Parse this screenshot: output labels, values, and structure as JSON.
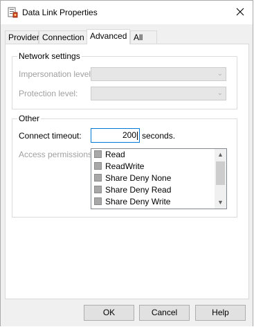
{
  "window": {
    "title": "Data Link Properties"
  },
  "tabs": [
    {
      "label": "Provider"
    },
    {
      "label": "Connection"
    },
    {
      "label": "Advanced"
    },
    {
      "label": "All"
    }
  ],
  "network_settings": {
    "group_label": "Network settings",
    "impersonation_label": "Impersonation level:",
    "impersonation_value": "",
    "protection_label": "Protection level:",
    "protection_value": ""
  },
  "other": {
    "group_label": "Other",
    "connect_timeout_label": "Connect timeout:",
    "connect_timeout_value": "200",
    "seconds_label": "seconds.",
    "access_permissions_label": "Access permissions:",
    "permissions": [
      {
        "label": "Read",
        "checked": false
      },
      {
        "label": "ReadWrite",
        "checked": false
      },
      {
        "label": "Share Deny None",
        "checked": false
      },
      {
        "label": "Share Deny Read",
        "checked": false
      },
      {
        "label": "Share Deny Write",
        "checked": false
      }
    ]
  },
  "buttons": {
    "ok": "OK",
    "cancel": "Cancel",
    "help": "Help"
  },
  "colors": {
    "focus_border": "#0078d7",
    "client_bg": "#f0f0f0",
    "disabled_text": "#a0a0a0"
  }
}
